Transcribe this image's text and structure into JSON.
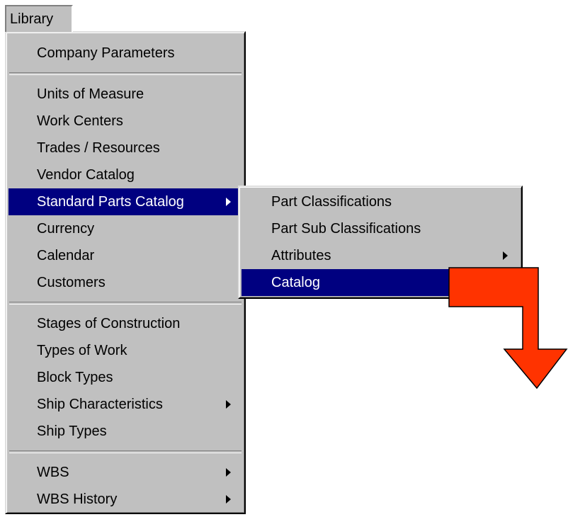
{
  "menubar": {
    "library_label": "Library"
  },
  "library_menu": {
    "groups": [
      {
        "items": [
          {
            "label": "Company Parameters"
          }
        ]
      },
      {
        "items": [
          {
            "label": "Units of Measure"
          },
          {
            "label": "Work Centers"
          },
          {
            "label": "Trades / Resources"
          },
          {
            "label": "Vendor Catalog"
          },
          {
            "label": "Standard Parts Catalog",
            "has_submenu": true,
            "highlighted": true
          },
          {
            "label": "Currency"
          },
          {
            "label": "Calendar"
          },
          {
            "label": "Customers"
          }
        ]
      },
      {
        "items": [
          {
            "label": "Stages of Construction"
          },
          {
            "label": "Types of Work"
          },
          {
            "label": "Block Types"
          },
          {
            "label": "Ship Characteristics",
            "has_submenu": true
          },
          {
            "label": "Ship Types"
          }
        ]
      },
      {
        "items": [
          {
            "label": "WBS",
            "has_submenu": true
          },
          {
            "label": "WBS History",
            "has_submenu": true
          }
        ]
      }
    ]
  },
  "standard_parts_submenu": {
    "items": [
      {
        "label": "Part Classifications"
      },
      {
        "label": "Part Sub Classifications"
      },
      {
        "label": "Attributes",
        "has_submenu": true
      },
      {
        "label": "Catalog",
        "highlighted": true
      }
    ]
  },
  "colors": {
    "menu_background": "#c0c0c0",
    "highlight_background": "#000080",
    "highlight_text": "#ffffff",
    "annotation_arrow_fill": "#ff3300"
  }
}
